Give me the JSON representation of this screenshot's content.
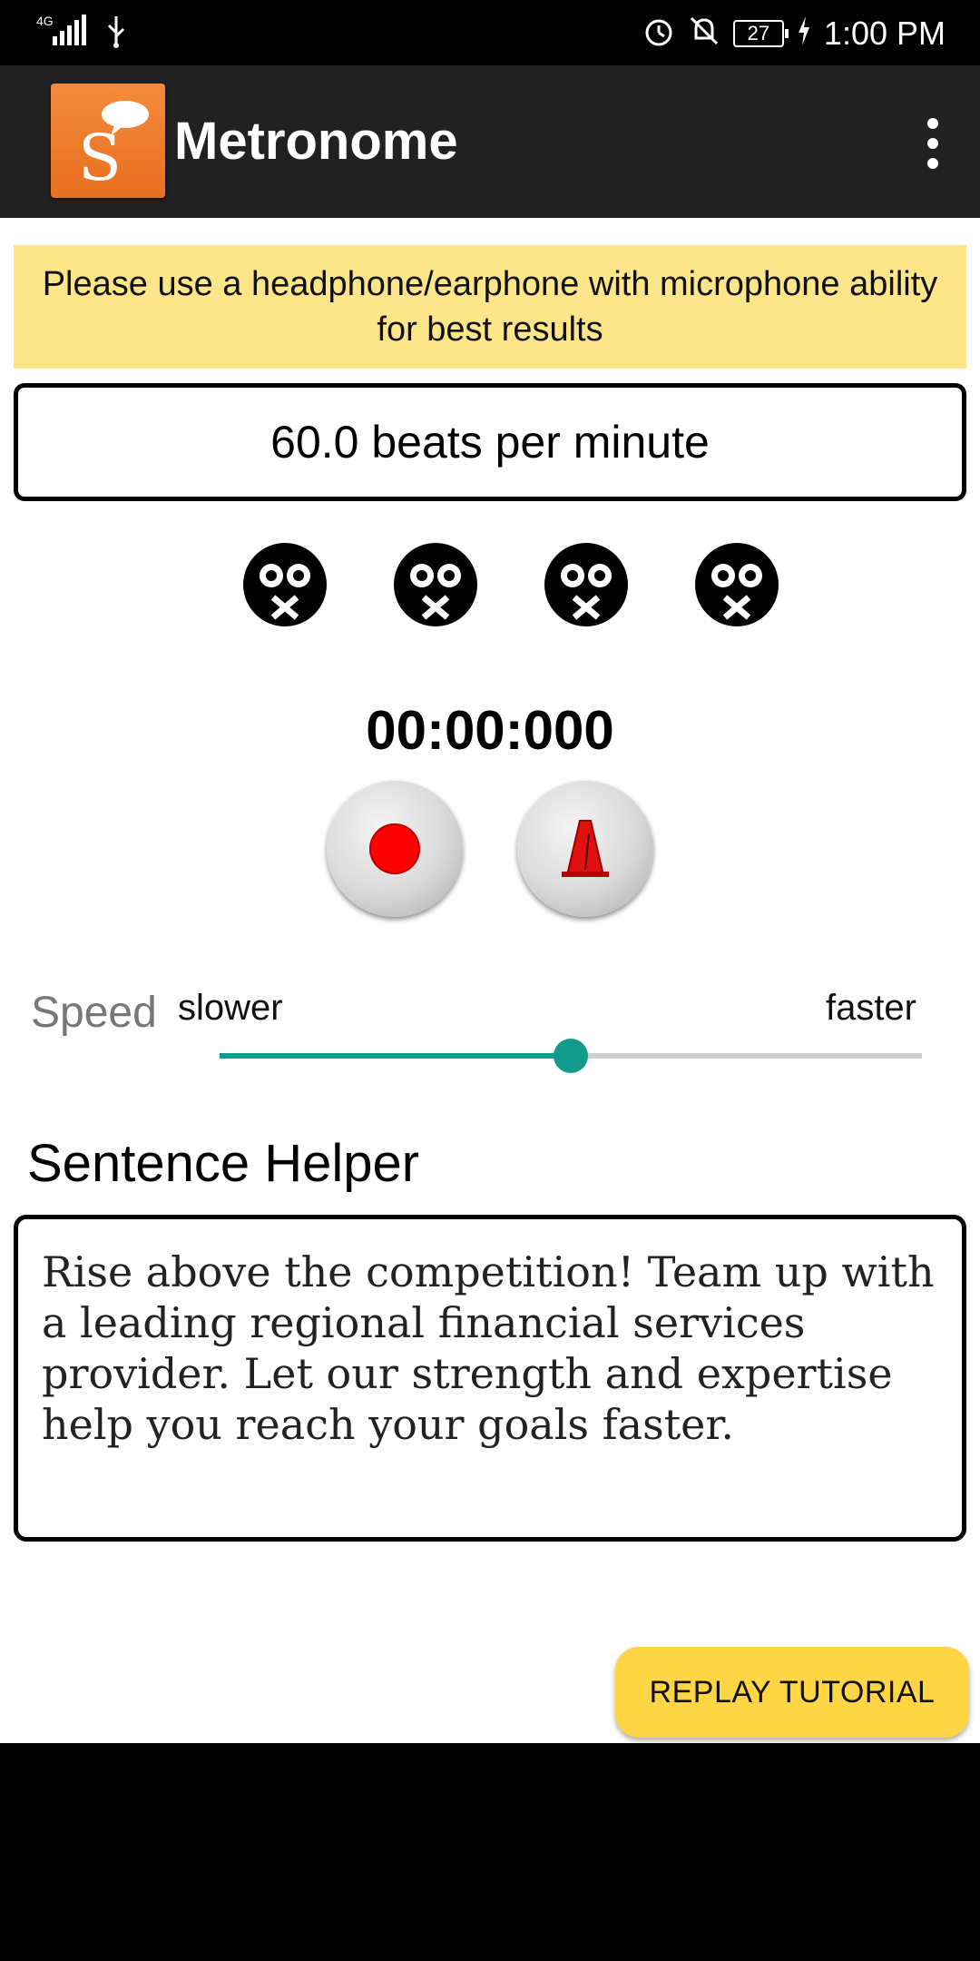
{
  "status_bar": {
    "network": "4G",
    "battery": "27",
    "time": "1:00 PM",
    "icons": [
      "signal-icon",
      "usb-icon",
      "alarm-icon",
      "notifications-off-icon",
      "battery-icon",
      "charging-icon"
    ]
  },
  "app_bar": {
    "title": "Metronome",
    "logo_letter": "S",
    "menu_icon": "more-vert-icon"
  },
  "banner": {
    "text": "Please use a headphone/earphone with microphone ability for best results"
  },
  "tempo": {
    "bpm_text": "60.0 beats per minute"
  },
  "beats": [
    {
      "icon": "skull-icon"
    },
    {
      "icon": "skull-icon"
    },
    {
      "icon": "skull-icon"
    },
    {
      "icon": "skull-icon"
    }
  ],
  "timer": {
    "value": "00:00:000"
  },
  "controls": {
    "record_icon": "record-icon",
    "metronome_icon": "metronome-icon"
  },
  "speed": {
    "label": "Speed",
    "slower": "slower",
    "faster": "faster",
    "value_fraction": 0.5
  },
  "sentence_helper": {
    "title": "Sentence Helper",
    "text": "Rise above the competition! Team up with a leading regional financial services provider. Let our strength and expertise help you reach your goals faster."
  },
  "replay_button": {
    "label": "REPLAY TUTORIAL"
  },
  "colors": {
    "accent": "#129a8c",
    "banner_bg": "#fde68a",
    "button_yellow": "#fdd545",
    "app_bar": "#212121",
    "app_icon": "#f58b3c"
  }
}
